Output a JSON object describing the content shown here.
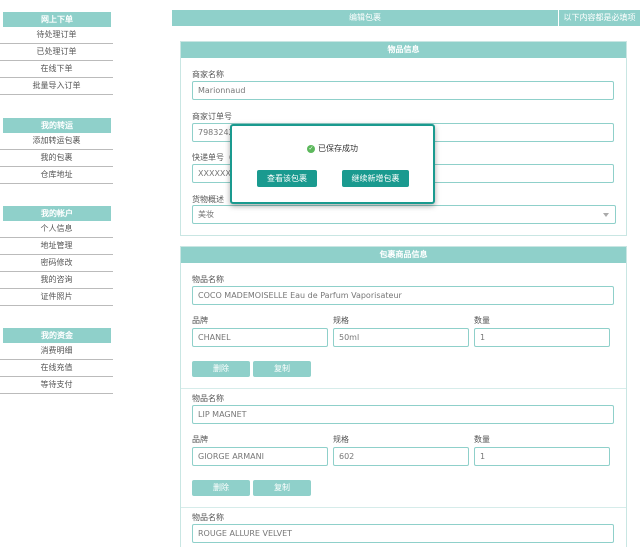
{
  "sidebar": {
    "groups": [
      {
        "title": "网上下单",
        "items": [
          "待处理订单",
          "已处理订单",
          "在线下单",
          "批量导入订单"
        ]
      },
      {
        "title": "我的转运",
        "items": [
          "添加转运包裹",
          "我的包裹",
          "仓库地址"
        ]
      },
      {
        "title": "我的帐户",
        "items": [
          "个人信息",
          "地址管理",
          "密码修改",
          "我的咨询",
          "证件照片"
        ]
      },
      {
        "title": "我的资金",
        "items": [
          "消费明细",
          "在线充值",
          "等待支付"
        ]
      }
    ]
  },
  "tabbar": {
    "main": "编辑包裹",
    "note": "以下内容都是必填项"
  },
  "goods_panel": {
    "title": "物品信息",
    "merchant_name_label": "商家名称",
    "merchant_name_value": "Marionnaud",
    "merchant_order_label": "商家订单号",
    "merchant_order_value": "79832426",
    "tracking_label": "快递单号（",
    "tracking_value": "XXXXXXX",
    "category_label": "货物概述",
    "category_value": "美妆"
  },
  "items_panel": {
    "title": "包裹商品信息",
    "name_label": "物品名称",
    "brand_label": "品牌",
    "spec_label": "规格",
    "qty_label": "数量",
    "delete_label": "删除",
    "copy_label": "复制",
    "items": [
      {
        "name": "COCO MADEMOISELLE Eau de Parfum Vaporisateur",
        "brand": "CHANEL",
        "spec": "50ml",
        "qty": "1"
      },
      {
        "name": "LIP MAGNET",
        "brand": "GIORGE ARMANI",
        "spec": "602",
        "qty": "1"
      },
      {
        "name": "ROUGE ALLURE VELVET"
      }
    ]
  },
  "dialog": {
    "message": "已保存成功",
    "view_button": "查看该包裹",
    "continue_button": "继续新增包裹"
  }
}
